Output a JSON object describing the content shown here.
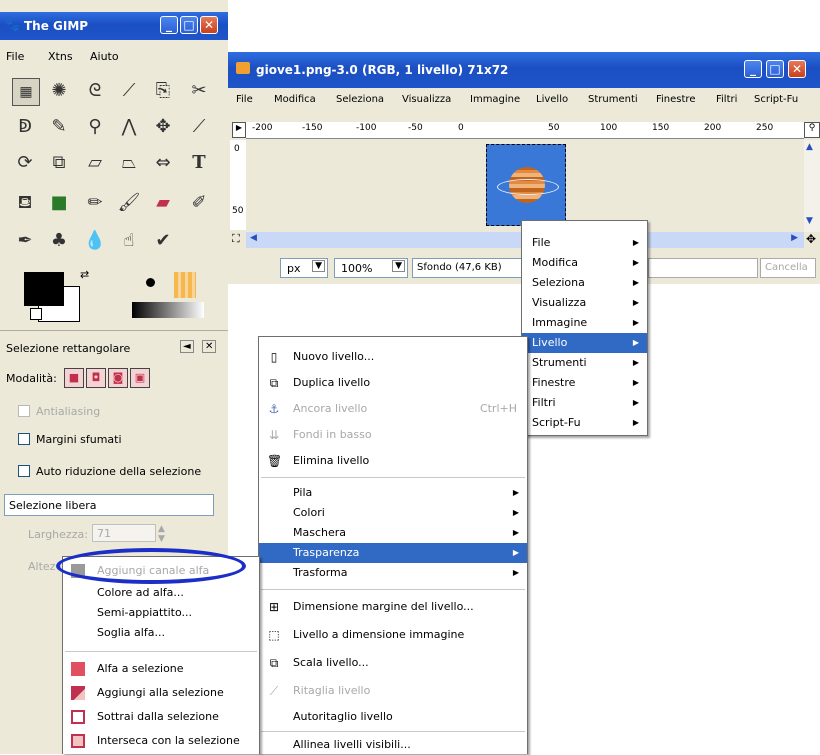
{
  "toolbox": {
    "title": "The GIMP",
    "menu": [
      "File",
      "Xtns",
      "Aiuto"
    ],
    "tool_options_title": "Selezione rettangolare",
    "mode_label": "Modalità:",
    "antialiasing": "Antialiasing",
    "feather": "Margini sfumati",
    "auto_shrink": "Auto riduzione della selezione",
    "selection_mode": "Selezione libera",
    "width_label": "Larghezza:",
    "width_value": "71",
    "height_label": "Altez"
  },
  "image_window": {
    "title": "giove1.png-3.0 (RGB, 1 livello) 71x72",
    "menu": [
      "File",
      "Modifica",
      "Seleziona",
      "Visualizza",
      "Immagine",
      "Livello",
      "Strumenti",
      "Finestre",
      "Filtri",
      "Script-Fu"
    ],
    "ruler_h": [
      "-200",
      "-150",
      "-100",
      "-50",
      "0",
      "50",
      "100",
      "150",
      "200",
      "250"
    ],
    "ruler_v": [
      "0",
      "50"
    ],
    "unit": "px",
    "zoom": "100%",
    "status": "Sfondo (47,6 KB)",
    "cancel": "Cancella"
  },
  "menu_main": [
    "File",
    "Modifica",
    "Seleziona",
    "Visualizza",
    "Immagine",
    "Livello",
    "Strumenti",
    "Finestre",
    "Filtri",
    "Script-Fu"
  ],
  "menu_layer": {
    "new": "Nuovo livello...",
    "duplicate": "Duplica livello",
    "anchor": "Ancora livello",
    "anchor_shortcut": "Ctrl+H",
    "merge_down": "Fondi in basso",
    "delete": "Elimina livello",
    "stack": "Pila",
    "colors": "Colori",
    "mask": "Maschera",
    "transparency": "Trasparenza",
    "transform": "Trasforma",
    "boundary_size": "Dimensione margine del livello...",
    "to_image_size": "Livello a dimensione immagine",
    "scale": "Scala livello...",
    "crop": "Ritaglia livello",
    "autocrop": "Autoritaglio livello",
    "align": "Allinea livelli visibili..."
  },
  "menu_transparency": {
    "add_alpha": "Aggiungi canale alfa",
    "color_to_alpha": "Colore ad alfa...",
    "semi_flatten": "Semi-appiattito...",
    "threshold_alpha": "Soglia alfa...",
    "alpha_to_selection": "Alfa a selezione",
    "add_to_selection": "Aggiungi alla selezione",
    "subtract_from_selection": "Sottrai dalla selezione",
    "intersect_selection": "Interseca con la selezione"
  },
  "colors": {
    "xp_blue": "#2458d4",
    "menu_highlight": "#316ac5",
    "annotation": "#1b2fc8",
    "canvas_bg": "#3a78d8"
  }
}
